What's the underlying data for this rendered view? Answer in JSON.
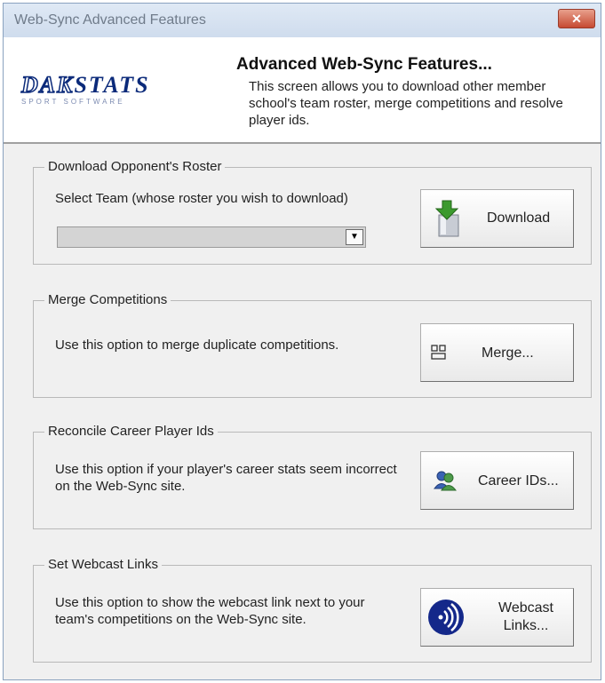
{
  "window": {
    "title": "Web-Sync Advanced Features",
    "close_label": "✕"
  },
  "header": {
    "logo_text_1": "DAK",
    "logo_text_2": "STATS",
    "logo_subtext": "SPORT SOFTWARE",
    "title": "Advanced Web-Sync Features...",
    "description": "This screen allows you to download other member school's team roster, merge competitions and resolve player ids."
  },
  "download_group": {
    "legend": "Download Opponent's Roster",
    "instruction": "Select Team (whose roster you wish to download)",
    "select_value": "",
    "button_label": "Download"
  },
  "merge_group": {
    "legend": "Merge Competitions",
    "description": "Use this option to merge duplicate competitions.",
    "button_label": "Merge..."
  },
  "career_group": {
    "legend": "Reconcile Career Player Ids",
    "description": "Use this option if your player's career stats seem incorrect on the Web-Sync site.",
    "button_label": "Career IDs..."
  },
  "webcast_group": {
    "legend": "Set Webcast Links",
    "description": "Use this option to show the webcast link next to your team's competitions on the Web-Sync site.",
    "button_label_line1": "Webcast",
    "button_label_line2": "Links..."
  },
  "colors": {
    "accent": "#0b2a7a",
    "close_button": "#c64a32",
    "download_icon_green": "#3c9a2e",
    "webcast_icon_blue": "#14288a"
  }
}
